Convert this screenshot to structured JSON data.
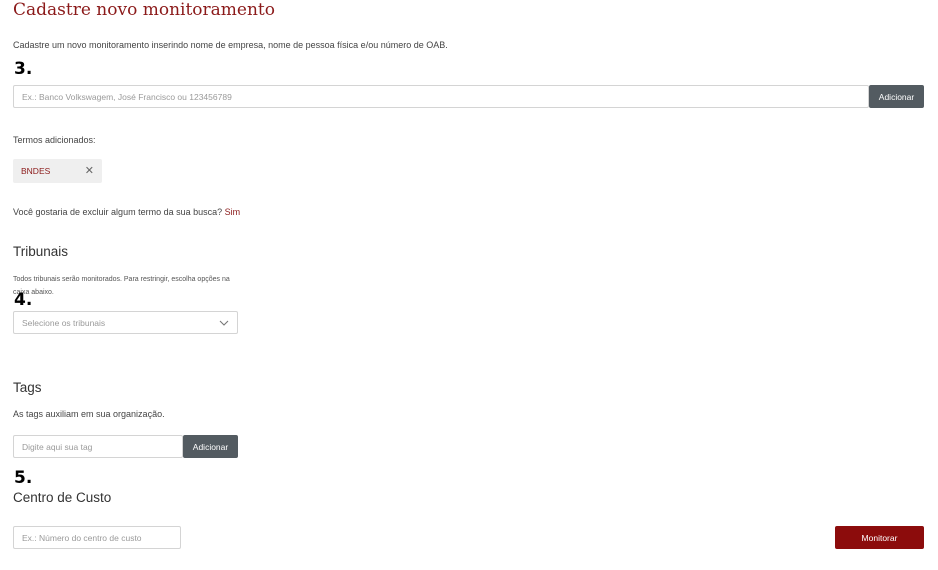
{
  "header": {
    "title": "Cadastre novo monitoramento",
    "description": "Cadastre um novo monitoramento inserindo nome de empresa, nome de pessoa física e/ou número de OAB."
  },
  "markers": {
    "step3": "3.",
    "step4": "4.",
    "step5": "5."
  },
  "terms": {
    "placeholder": "Ex.: Banco Volkswagem, José Francisco ou 123456789",
    "add_label": "Adicionar",
    "added_heading": "Termos adicionados:",
    "chips": [
      {
        "label": "BNDES",
        "remove_icon": "close-icon"
      }
    ],
    "exclude_question": "Você gostaria de excluir algum termo da sua busca?",
    "exclude_link": "Sim"
  },
  "tribunais": {
    "heading": "Tribunais",
    "hint": "Todos tribunais serão monitorados. Para restringir, escolha opções na caixa abaixo.",
    "select_placeholder": "Selecione os tribunais",
    "select_icon": "chevron-down-icon"
  },
  "tags": {
    "heading": "Tags",
    "description": "As tags auxiliam em sua organização.",
    "placeholder": "Digite aqui sua tag",
    "add_label": "Adicionar"
  },
  "cost_center": {
    "heading": "Centro de Custo",
    "placeholder": "Ex.: Número do centro de custo"
  },
  "submit": {
    "label": "Monitorar"
  },
  "colors": {
    "brand": "#8c0c0c",
    "dark_button": "#535b61",
    "chip_bg": "#efefef"
  }
}
